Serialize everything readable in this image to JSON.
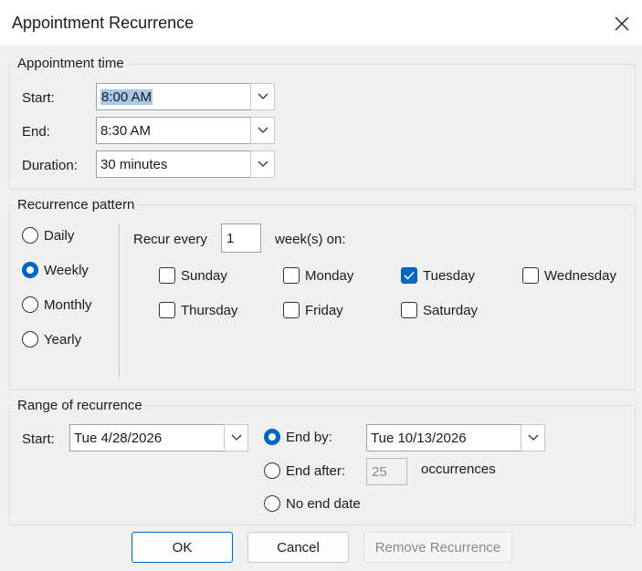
{
  "window": {
    "title": "Appointment Recurrence"
  },
  "appointment_time": {
    "legend": "Appointment time",
    "start_label": "Start:",
    "start_value": "8:00 AM",
    "end_label": "End:",
    "end_value": "8:30 AM",
    "duration_label": "Duration:",
    "duration_value": "30 minutes"
  },
  "recurrence_pattern": {
    "legend": "Recurrence pattern",
    "types": [
      "Daily",
      "Weekly",
      "Monthly",
      "Yearly"
    ],
    "selected_type": "Weekly",
    "recur_every_label": "Recur every",
    "recur_every_value": "1",
    "weeks_on_label": "week(s) on:",
    "days": [
      "Sunday",
      "Monday",
      "Tuesday",
      "Wednesday",
      "Thursday",
      "Friday",
      "Saturday"
    ],
    "checked_days": [
      "Tuesday"
    ]
  },
  "range": {
    "legend": "Range of recurrence",
    "start_label": "Start:",
    "start_value": "Tue 4/28/2026",
    "end_by_label": "End by:",
    "end_by_value": "Tue 10/13/2026",
    "end_after_label": "End after:",
    "end_after_value": "25",
    "occurrences_label": "occurrences",
    "no_end_label": "No end date",
    "selected_option": "End by"
  },
  "buttons": {
    "ok": "OK",
    "cancel": "Cancel",
    "remove": "Remove Recurrence"
  },
  "colors": {
    "accent": "#0067c0",
    "selection": "#a8c8e8"
  },
  "icons": {
    "close": "close-icon",
    "dropdown": "chevron-down-icon",
    "check": "checkmark-icon"
  }
}
